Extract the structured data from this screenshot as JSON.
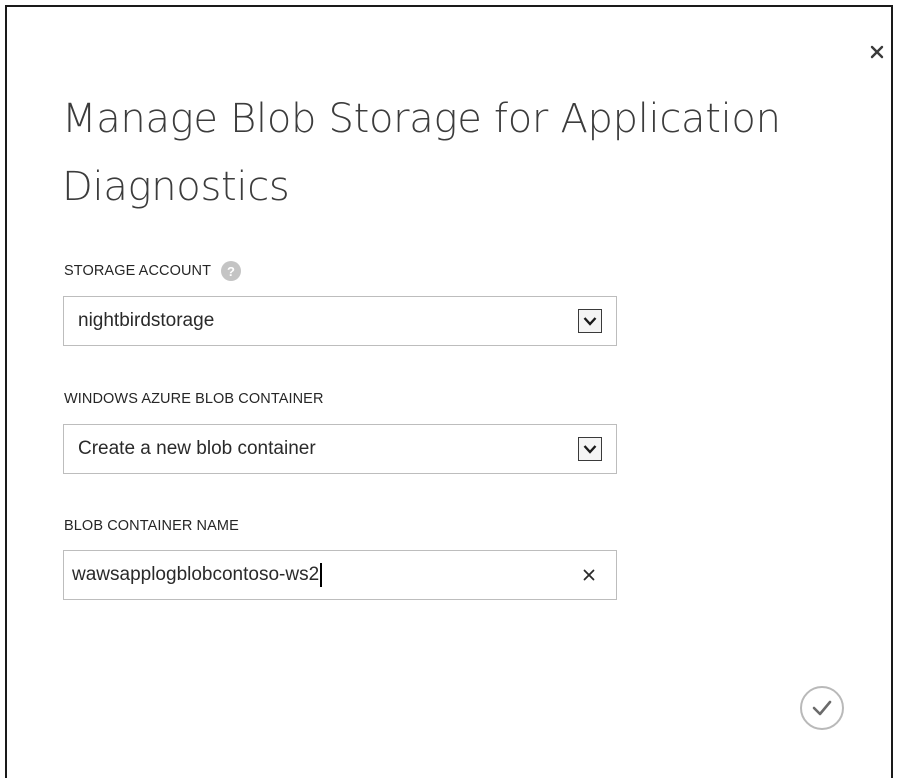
{
  "dialog": {
    "title": "Manage Blob Storage for Application Diagnostics",
    "close_icon": "close-icon",
    "confirm_icon": "checkmark-icon"
  },
  "fields": {
    "storage_account": {
      "label": "STORAGE ACCOUNT",
      "help_icon": "question-mark-icon",
      "help_glyph": "?",
      "value": "nightbirdstorage"
    },
    "blob_container": {
      "label": "WINDOWS AZURE BLOB CONTAINER",
      "value": "Create a new blob container"
    },
    "container_name": {
      "label": "BLOB CONTAINER NAME",
      "value": "wawsapplogblobcontoso-ws2"
    }
  },
  "colors": {
    "title_text": "#3c3c3c",
    "border": "#bdbdbd",
    "help_icon_bg": "#c4c4c4"
  }
}
